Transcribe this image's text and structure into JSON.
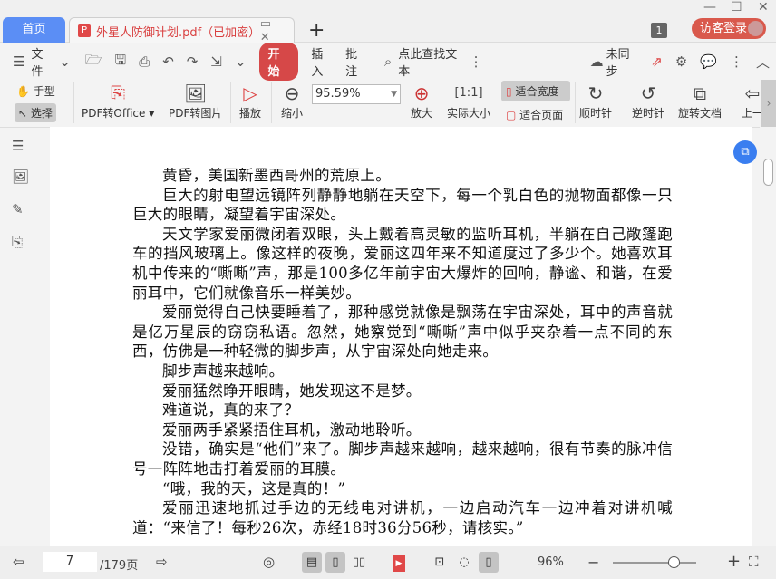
{
  "tabs": {
    "home": "首页",
    "doc": "外星人防御计划.pdf（已加密）",
    "new": "+"
  },
  "window": {
    "count": "1",
    "login": "访客登录"
  },
  "menu": {
    "file": "文件",
    "start": "开始",
    "insert": "插入",
    "annotate": "批注",
    "search_placeholder": "点此查找文本",
    "sync": "未同步"
  },
  "ribbon": {
    "hand": "手型",
    "select": "选择",
    "pdf_office": "PDF转Office",
    "pdf_image": "PDF转图片",
    "play": "播放",
    "zoom_out": "缩小",
    "zoom_value": "95.59%",
    "zoom_in": "放大",
    "actual_size": "实际大小",
    "fit_width": "适合宽度",
    "fit_page": "适合页面",
    "clockwise": "顺时针",
    "counter_clockwise": "逆时针",
    "rotate_doc": "旋转文档",
    "prev": "上一"
  },
  "document": {
    "paragraphs": [
      "黄昏，美国新墨西哥州的荒原上。",
      "巨大的射电望远镜阵列静静地躺在天空下，每一个乳白色的抛物面都像一只巨大的眼睛，凝望着宇宙深处。",
      "天文学家爱丽微闭着双眼，头上戴着高灵敏的监听耳机，半躺在自己敞篷跑车的挡风玻璃上。像这样的夜晚，爱丽这四年来不知道度过了多少个。她喜欢耳机中传来的“嘶嘶”声，那是100多亿年前宇宙大爆炸的回响，静谧、和谐，在爱丽耳中，它们就像音乐一样美妙。",
      "爱丽觉得自己快要睡着了，那种感觉就像是飘荡在宇宙深处，耳中的声音就是亿万星辰的窃窃私语。忽然，她察觉到“嘶嘶”声中似乎夹杂着一点不同的东西，仿佛是一种轻微的脚步声，从宇宙深处向她走来。",
      "脚步声越来越响。",
      "爱丽猛然睁开眼睛，她发现这不是梦。",
      "难道说，真的来了？",
      "爱丽两手紧紧捂住耳机，激动地聆听。",
      "没错，确实是“他们”来了。脚步声越来越响，越来越响，很有节奏的脉冲信号一阵阵地击打着爱丽的耳膜。",
      "“哦，我的天，这是真的！”",
      "爱丽迅速地抓过手边的无线电对讲机，一边启动汽车一边冲着对讲机喊道：“来信了！每秒26次，赤经18时36分56秒，请核实。”"
    ]
  },
  "status": {
    "page": "7",
    "total": "/179页",
    "zoom": "96%"
  }
}
